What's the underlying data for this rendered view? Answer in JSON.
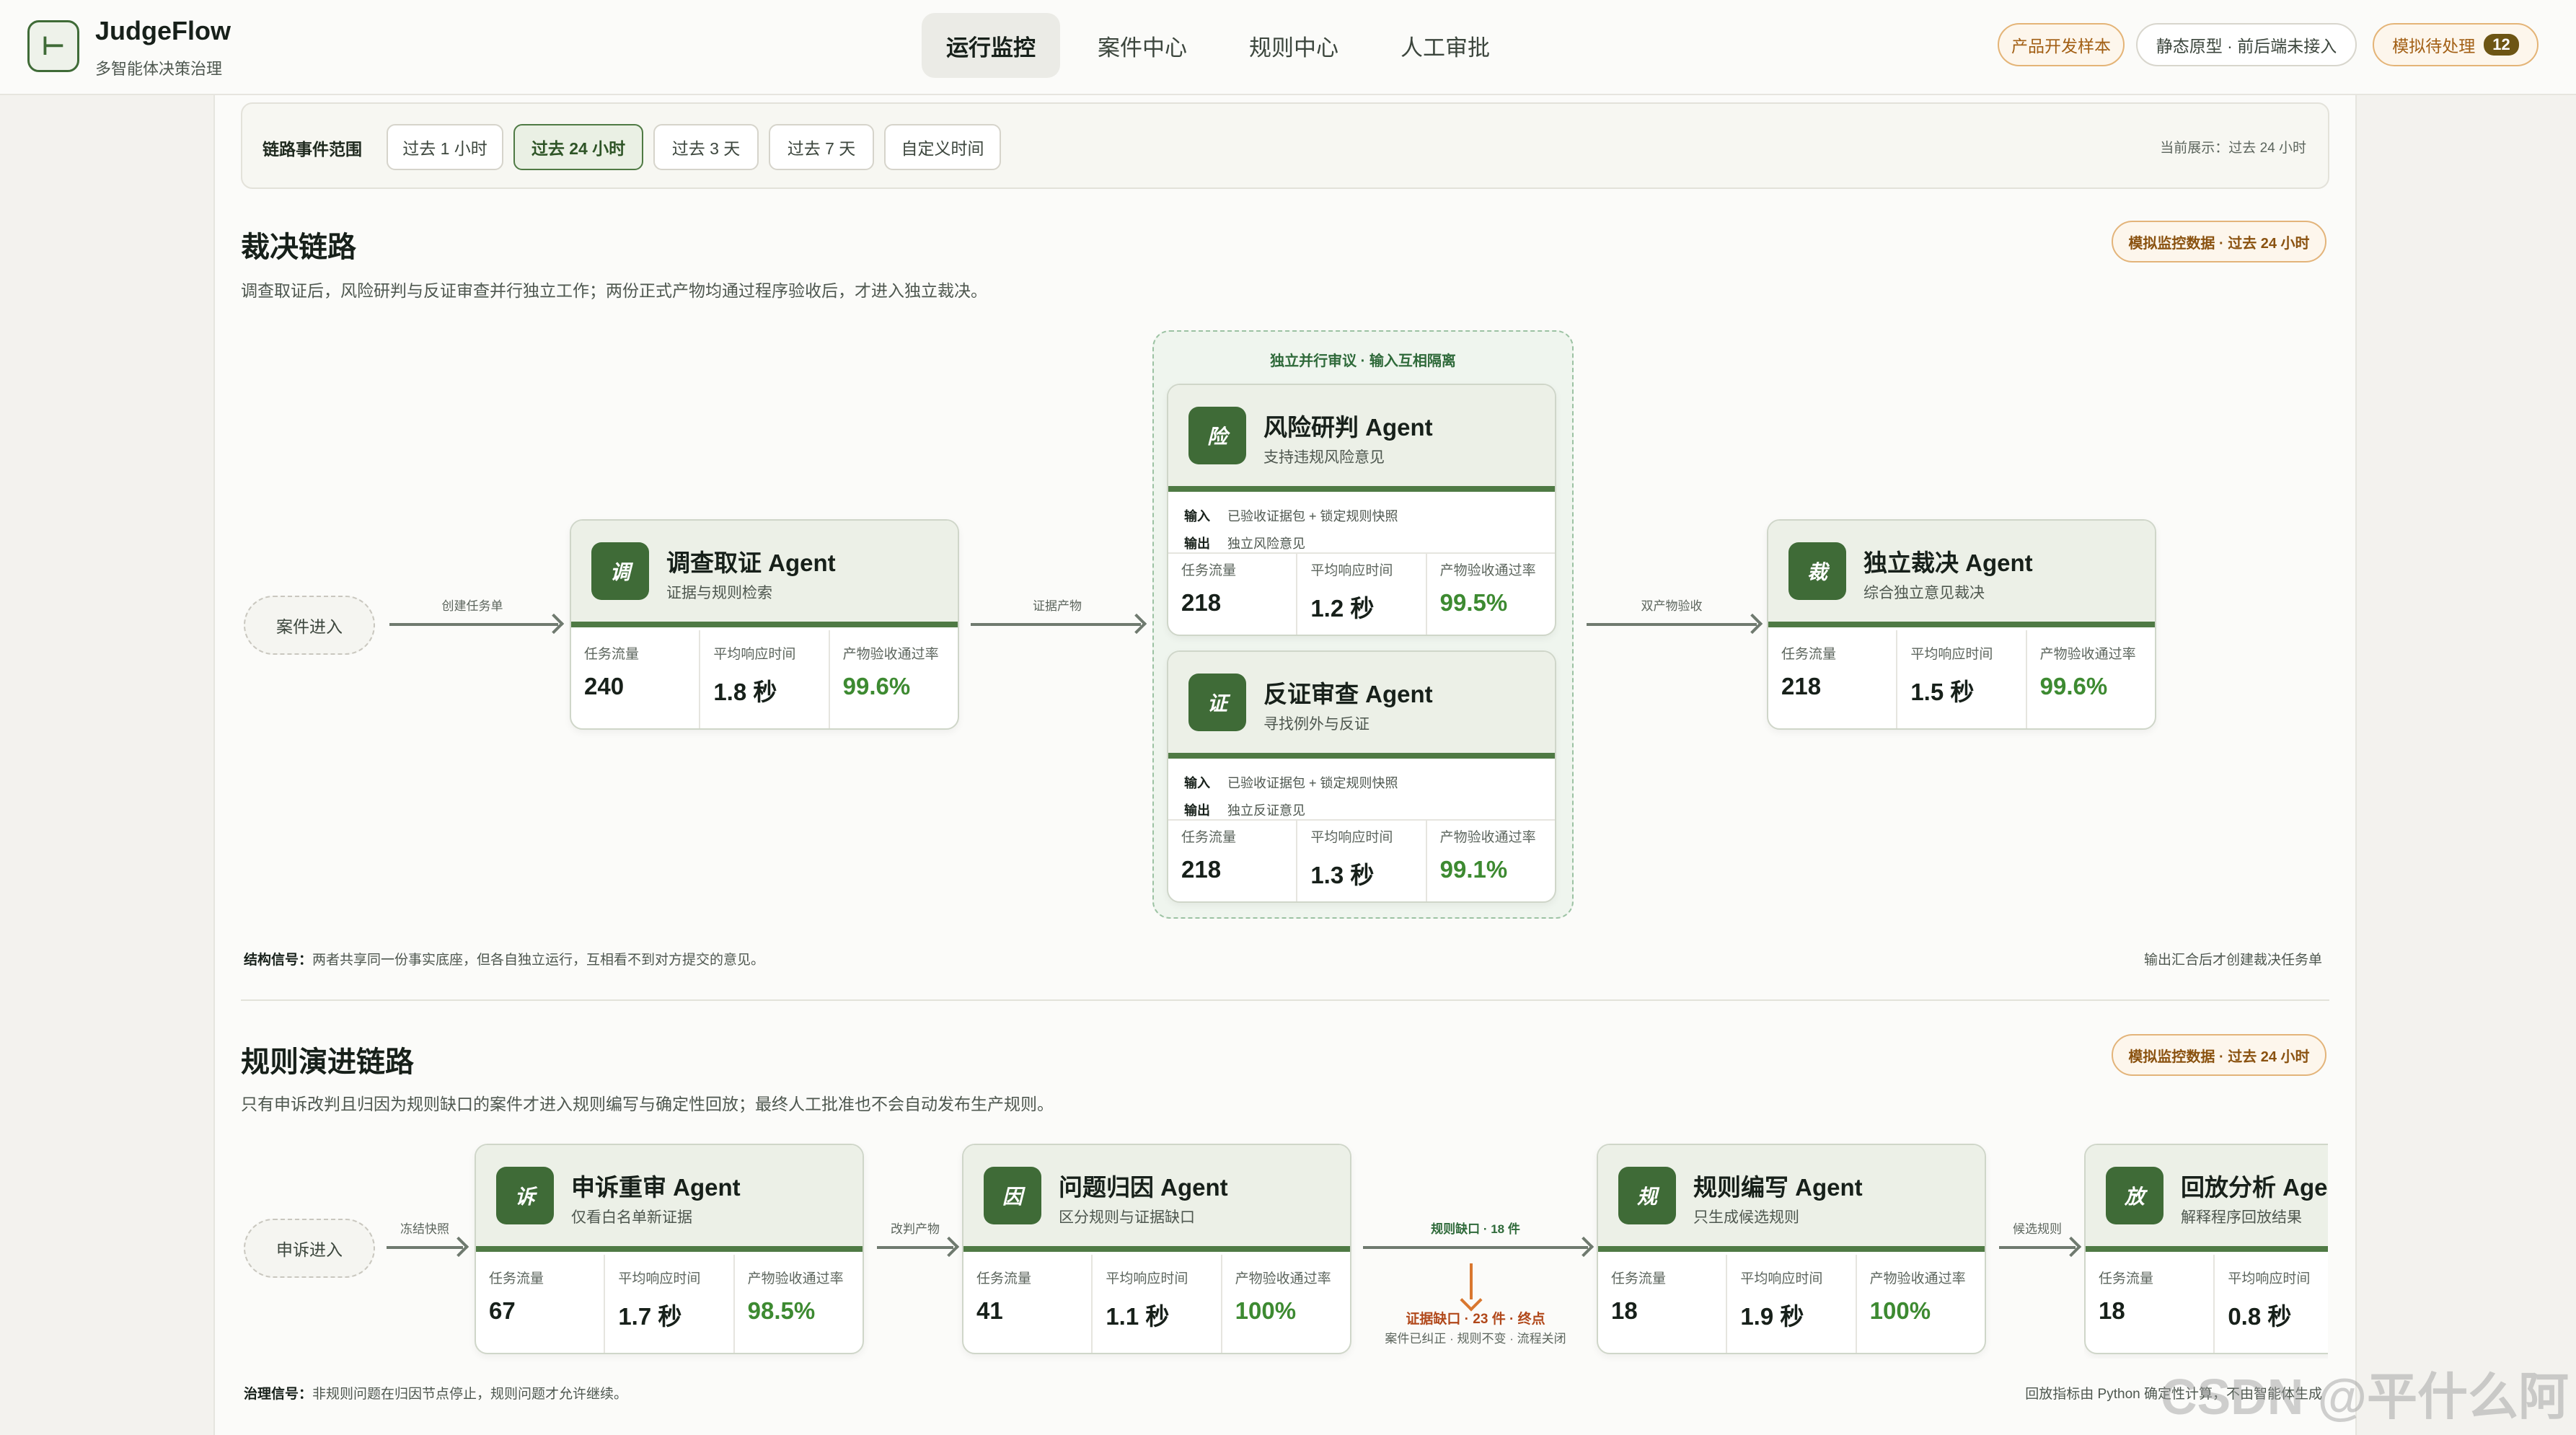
{
  "app": {
    "logo_glyph": "⊢",
    "name": "JudgeFlow",
    "subtitle": "多智能体决策治理"
  },
  "nav": [
    "运行监控",
    "案件中心",
    "规则中心",
    "人工审批"
  ],
  "header_pills": {
    "sample": "产品开发样本",
    "static": "静态原型 · 前后端未接入",
    "pending": "模拟待处理",
    "pending_count": "12"
  },
  "filter": {
    "label": "链路事件范围",
    "options": [
      "过去 1 小时",
      "过去 24 小时",
      "过去 3 天",
      "过去 7 天",
      "自定义时间"
    ],
    "selected": "过去 24 小时",
    "current": "当前展示：过去 24 小时"
  },
  "metric_labels": {
    "flow": "任务流量",
    "latency": "平均响应时间",
    "pass": "产物验收通过率"
  },
  "adjudication": {
    "title": "裁决链路",
    "desc": "调查取证后，风险研判与反证审查并行独立工作；两份正式产物均通过程序验收后，才进入独立裁决。",
    "tag": "模拟监控数据 · 过去 24 小时",
    "entry": "案件进入",
    "edges": [
      "创建任务单",
      "证据产物",
      "双产物验收"
    ],
    "parallel_label": "独立并行审议 · 输入互相隔离",
    "io_labels": {
      "in": "输入",
      "out": "输出"
    },
    "cards": [
      {
        "icon": "调",
        "title": "调查取证 Agent",
        "sub": "证据与规则检索",
        "flow": "240",
        "latency": "1.8 秒",
        "pass": "99.6%"
      },
      {
        "icon": "险",
        "title": "风险研判 Agent",
        "sub": "支持违规风险意见",
        "input": "已验收证据包 + 锁定规则快照",
        "output": "独立风险意见",
        "flow": "218",
        "latency": "1.2 秒",
        "pass": "99.5%"
      },
      {
        "icon": "证",
        "title": "反证审查 Agent",
        "sub": "寻找例外与反证",
        "input": "已验收证据包 + 锁定规则快照",
        "output": "独立反证意见",
        "flow": "218",
        "latency": "1.3 秒",
        "pass": "99.1%"
      },
      {
        "icon": "裁",
        "title": "独立裁决 Agent",
        "sub": "综合独立意见裁决",
        "flow": "218",
        "latency": "1.5 秒",
        "pass": "99.6%"
      }
    ],
    "signal_label": "结构信号：",
    "signal": "两者共享同一份事实底座，但各自独立运行，互相看不到对方提交的意见。",
    "signal_right": "输出汇合后才创建裁决任务单"
  },
  "rules": {
    "title": "规则演进链路",
    "desc": "只有申诉改判且归因为规则缺口的案件才进入规则编写与确定性回放；最终人工批准也不会自动发布生产规则。",
    "tag": "模拟监控数据 · 过去 24 小时",
    "entry": "申诉进入",
    "edges": [
      "冻结快照",
      "改判产物",
      "规则缺口 · 18 件",
      "候选规则"
    ],
    "evidence_gap": "证据缺口 · 23 件 · 终点",
    "evidence_note": "案件已纠正 · 规则不变 · 流程关闭",
    "cards": [
      {
        "icon": "诉",
        "title": "申诉重审 Agent",
        "sub": "仅看白名单新证据",
        "flow": "67",
        "latency": "1.7 秒",
        "pass": "98.5%"
      },
      {
        "icon": "因",
        "title": "问题归因 Agent",
        "sub": "区分规则与证据缺口",
        "flow": "41",
        "latency": "1.1 秒",
        "pass": "100%"
      },
      {
        "icon": "规",
        "title": "规则编写 Agent",
        "sub": "只生成候选规则",
        "flow": "18",
        "latency": "1.9 秒",
        "pass": "100%"
      },
      {
        "icon": "放",
        "title": "回放分析 Agent",
        "sub": "解释程序回放结果",
        "flow": "18",
        "latency": "0.8 秒",
        "pass": ""
      }
    ],
    "signal_label": "治理信号：",
    "signal": "非规则问题在归因节点停止，规则问题才允许继续。",
    "signal_right": "回放指标由 Python 确定性计算，不由智能体生成"
  },
  "watermark": "CSDN @平什么阿"
}
